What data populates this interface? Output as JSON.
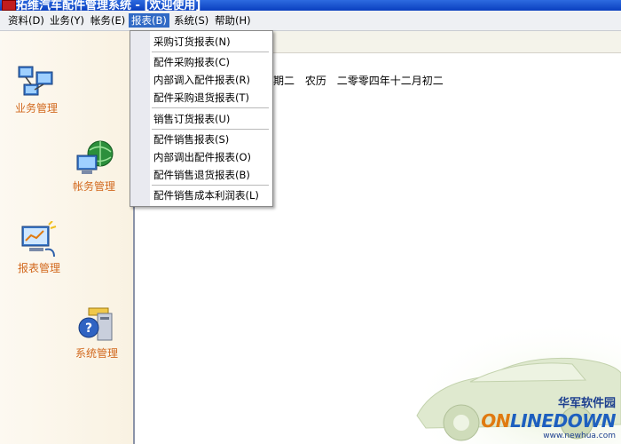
{
  "window": {
    "title": "拓维汽车配件管理系统 - [欢迎使用]"
  },
  "menubar": {
    "items": [
      {
        "label": "资料(D)"
      },
      {
        "label": "业务(Y)"
      },
      {
        "label": "帐务(E)"
      },
      {
        "label": "报表(B)"
      },
      {
        "label": "系统(S)"
      },
      {
        "label": "帮助(H)"
      }
    ],
    "active": "报表(B)"
  },
  "sidebar": {
    "items": [
      {
        "label": "业务管理",
        "icon": "computers-network-icon"
      },
      {
        "label": "帐务管理",
        "icon": "computer-globe-icon"
      },
      {
        "label": "报表管理",
        "icon": "monitor-report-icon"
      },
      {
        "label": "系统管理",
        "icon": "help-computer-icon"
      }
    ]
  },
  "main": {
    "weekday": "星期二",
    "lunar_label": "农历",
    "lunar_date": "二零零四年十二月初二"
  },
  "report_menu": {
    "items": [
      {
        "label": "采购订货报表(N)"
      },
      {
        "label": "配件采购报表(C)"
      },
      {
        "label": "内部调入配件报表(R)"
      },
      {
        "label": "配件采购退货报表(T)"
      },
      {
        "label": "销售订货报表(U)"
      },
      {
        "label": "配件销售报表(S)"
      },
      {
        "label": "内部调出配件报表(O)"
      },
      {
        "label": "配件销售退货报表(B)"
      },
      {
        "label": "配件销售成本利润表(L)"
      }
    ]
  },
  "watermark": {
    "cn": "华军软件园",
    "brand_on": "ON",
    "brand_rest": "LINEDOWN",
    "url": "www.newhua.com"
  },
  "colors": {
    "title_bar": "#0a3fbf",
    "menu_highlight": "#316ac5",
    "sidebar_label": "#d2691e"
  }
}
